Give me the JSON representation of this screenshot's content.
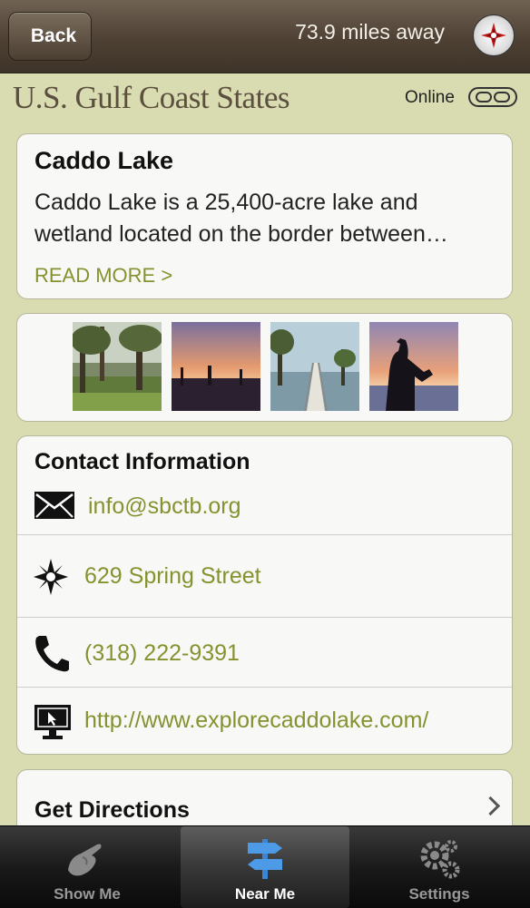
{
  "navbar": {
    "back_label": "Back",
    "distance": "73.9 miles away"
  },
  "header": {
    "region_title": "U.S. Gulf Coast States",
    "online_label": "Online"
  },
  "description": {
    "title": "Caddo Lake",
    "text": "Caddo Lake is a 25,400-acre lake and wetland located on the border between…",
    "read_more": "READ MORE >"
  },
  "contact": {
    "title": "Contact Information",
    "items": [
      {
        "icon": "envelope-icon",
        "text": "info@sbctb.org"
      },
      {
        "icon": "compass-rose-icon",
        "text": "629 Spring Street"
      },
      {
        "icon": "phone-icon",
        "text": "(318) 222-9391"
      },
      {
        "icon": "monitor-icon",
        "text": "http://www.explorecaddolake.com/"
      }
    ]
  },
  "directions": {
    "label": "Get Directions"
  },
  "tabbar": {
    "tabs": [
      {
        "label": "Show Me",
        "icon": "pointing-hand-icon"
      },
      {
        "label": "Near Me",
        "icon": "signpost-icon",
        "active": true
      },
      {
        "label": "Settings",
        "icon": "gears-icon"
      }
    ]
  },
  "colors": {
    "accent_link": "#86922f",
    "background": "#d9dbb0",
    "navbar": "#4e4134"
  }
}
